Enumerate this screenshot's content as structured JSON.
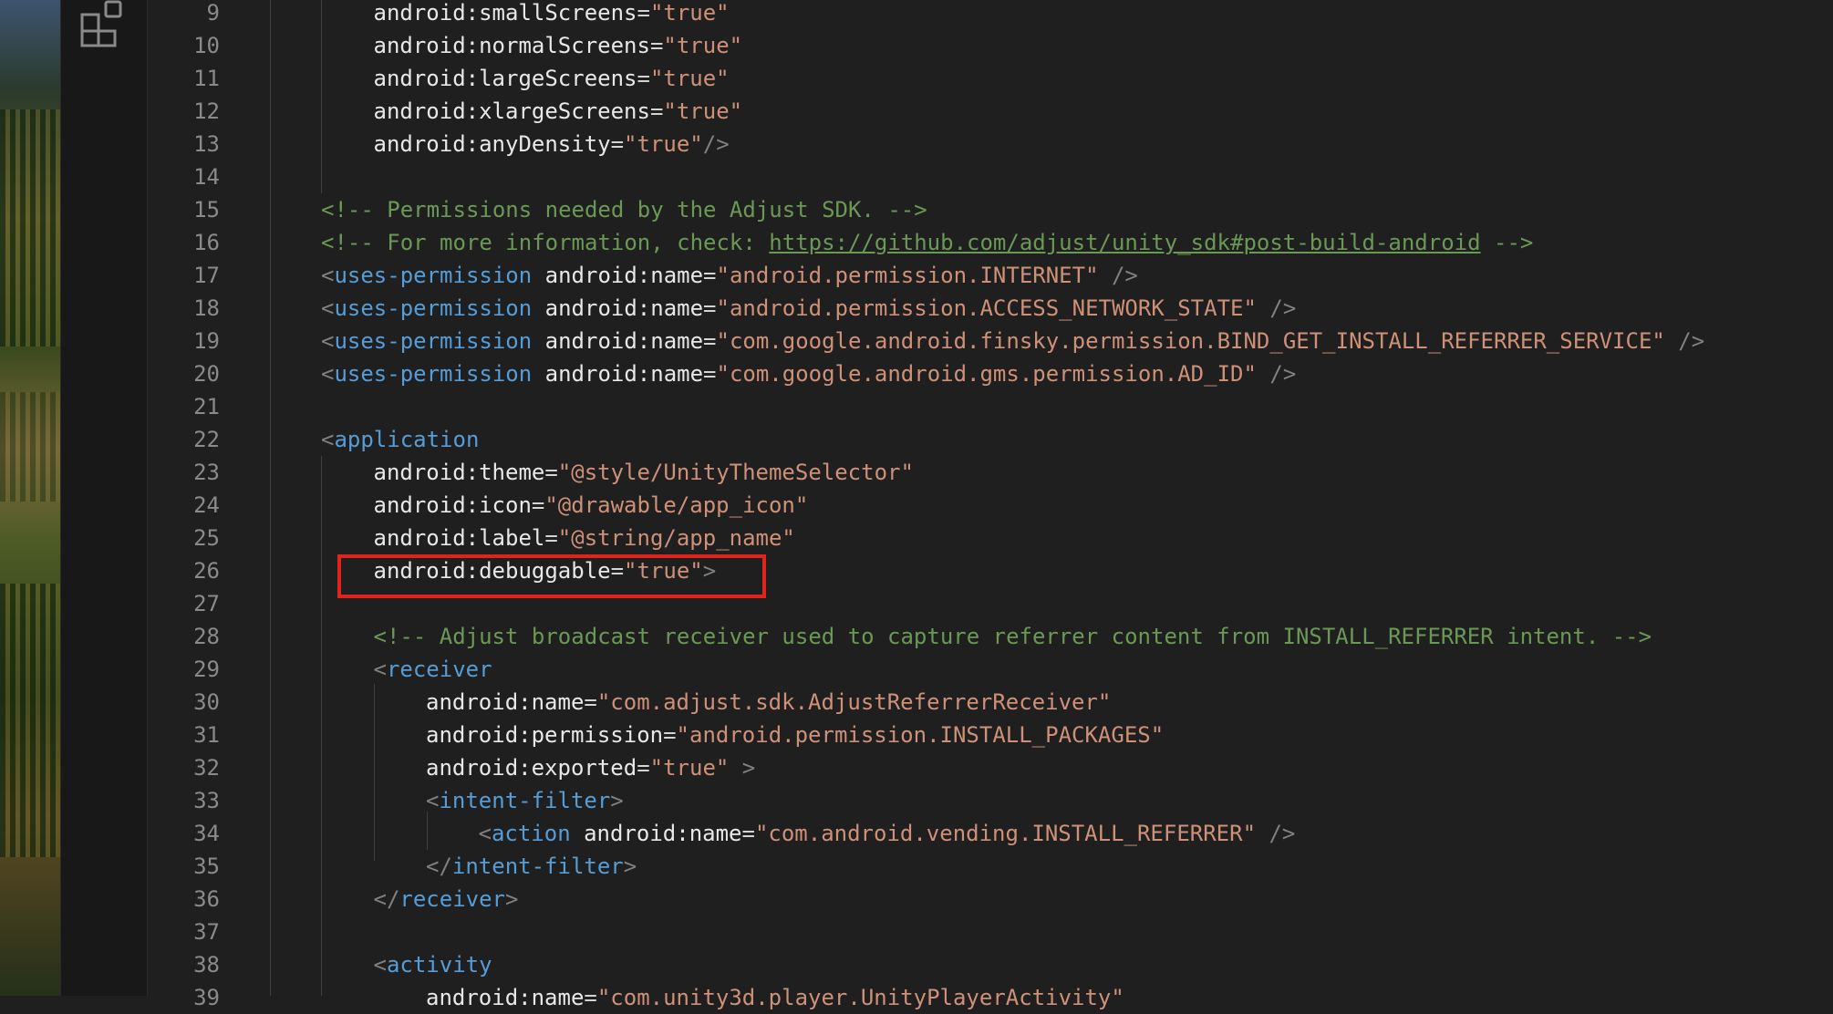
{
  "highlight_color": "#e0241c",
  "editor": {
    "lines": [
      {
        "num": "9",
        "tokens": [
          [
            "attr-w",
            "android:smallScreens"
          ],
          [
            "txt",
            "="
          ],
          [
            "str",
            "\"true\""
          ]
        ],
        "indent": 2
      },
      {
        "num": "10",
        "tokens": [
          [
            "attr-w",
            "android:normalScreens"
          ],
          [
            "txt",
            "="
          ],
          [
            "str",
            "\"true\""
          ]
        ],
        "indent": 2
      },
      {
        "num": "11",
        "tokens": [
          [
            "attr-w",
            "android:largeScreens"
          ],
          [
            "txt",
            "="
          ],
          [
            "str",
            "\"true\""
          ]
        ],
        "indent": 2
      },
      {
        "num": "12",
        "tokens": [
          [
            "attr-w",
            "android:xlargeScreens"
          ],
          [
            "txt",
            "="
          ],
          [
            "str",
            "\"true\""
          ]
        ],
        "indent": 2
      },
      {
        "num": "13",
        "tokens": [
          [
            "attr-w",
            "android:anyDensity"
          ],
          [
            "txt",
            "="
          ],
          [
            "str",
            "\"true\""
          ],
          [
            "brk",
            "/>"
          ]
        ],
        "indent": 2
      },
      {
        "num": "14",
        "tokens": [],
        "indent": 1
      },
      {
        "num": "15",
        "tokens": [
          [
            "com",
            "<!-- Permissions needed by the Adjust SDK. -->"
          ]
        ],
        "indent": 1
      },
      {
        "num": "16",
        "tokens": [
          [
            "com",
            "<!-- For more information, check: "
          ],
          [
            "link",
            "https://github.com/adjust/unity_sdk#post-build-android"
          ],
          [
            "com",
            " -->"
          ]
        ],
        "indent": 1
      },
      {
        "num": "17",
        "tokens": [
          [
            "brk",
            "<"
          ],
          [
            "tag",
            "uses-permission"
          ],
          [
            "txt",
            " "
          ],
          [
            "attr-w",
            "android:name"
          ],
          [
            "txt",
            "="
          ],
          [
            "str",
            "\"android.permission.INTERNET\""
          ],
          [
            "brk",
            " />"
          ]
        ],
        "indent": 1
      },
      {
        "num": "18",
        "tokens": [
          [
            "brk",
            "<"
          ],
          [
            "tag",
            "uses-permission"
          ],
          [
            "txt",
            " "
          ],
          [
            "attr-w",
            "android:name"
          ],
          [
            "txt",
            "="
          ],
          [
            "str",
            "\"android.permission.ACCESS_NETWORK_STATE\""
          ],
          [
            "brk",
            " />"
          ]
        ],
        "indent": 1
      },
      {
        "num": "19",
        "tokens": [
          [
            "brk",
            "<"
          ],
          [
            "tag",
            "uses-permission"
          ],
          [
            "txt",
            " "
          ],
          [
            "attr-w",
            "android:name"
          ],
          [
            "txt",
            "="
          ],
          [
            "str",
            "\"com.google.android.finsky.permission.BIND_GET_INSTALL_REFERRER_SERVICE\""
          ],
          [
            "brk",
            " />"
          ]
        ],
        "indent": 1
      },
      {
        "num": "20",
        "tokens": [
          [
            "brk",
            "<"
          ],
          [
            "tag",
            "uses-permission"
          ],
          [
            "txt",
            " "
          ],
          [
            "attr-w",
            "android:name"
          ],
          [
            "txt",
            "="
          ],
          [
            "str",
            "\"com.google.android.gms.permission.AD_ID\""
          ],
          [
            "brk",
            " />"
          ]
        ],
        "indent": 1
      },
      {
        "num": "21",
        "tokens": [],
        "indent": 1
      },
      {
        "num": "22",
        "tokens": [
          [
            "brk",
            "<"
          ],
          [
            "tag",
            "application"
          ]
        ],
        "indent": 1
      },
      {
        "num": "23",
        "tokens": [
          [
            "attr-w",
            "android:theme"
          ],
          [
            "txt",
            "="
          ],
          [
            "str",
            "\"@style/UnityThemeSelector\""
          ]
        ],
        "indent": 2
      },
      {
        "num": "24",
        "tokens": [
          [
            "attr-w",
            "android:icon"
          ],
          [
            "txt",
            "="
          ],
          [
            "str",
            "\"@drawable/app_icon\""
          ]
        ],
        "indent": 2
      },
      {
        "num": "25",
        "tokens": [
          [
            "attr-w",
            "android:label"
          ],
          [
            "txt",
            "="
          ],
          [
            "str",
            "\"@string/app_name\""
          ]
        ],
        "indent": 2
      },
      {
        "num": "26",
        "tokens": [
          [
            "attr-w",
            "android:debuggable"
          ],
          [
            "txt",
            "="
          ],
          [
            "str",
            "\"true\""
          ],
          [
            "brk",
            ">"
          ]
        ],
        "indent": 2
      },
      {
        "num": "27",
        "tokens": [],
        "indent": 2
      },
      {
        "num": "28",
        "tokens": [
          [
            "com",
            "<!-- Adjust broadcast receiver used to capture referrer content from INSTALL_REFERRER intent. -->"
          ]
        ],
        "indent": 2
      },
      {
        "num": "29",
        "tokens": [
          [
            "brk",
            "<"
          ],
          [
            "tag",
            "receiver"
          ]
        ],
        "indent": 2
      },
      {
        "num": "30",
        "tokens": [
          [
            "attr-w",
            "android:name"
          ],
          [
            "txt",
            "="
          ],
          [
            "str",
            "\"com.adjust.sdk.AdjustReferrerReceiver\""
          ]
        ],
        "indent": 3
      },
      {
        "num": "31",
        "tokens": [
          [
            "attr-w",
            "android:permission"
          ],
          [
            "txt",
            "="
          ],
          [
            "str",
            "\"android.permission.INSTALL_PACKAGES\""
          ]
        ],
        "indent": 3
      },
      {
        "num": "32",
        "tokens": [
          [
            "attr-w",
            "android:exported"
          ],
          [
            "txt",
            "="
          ],
          [
            "str",
            "\"true\""
          ],
          [
            "brk",
            " >"
          ]
        ],
        "indent": 3
      },
      {
        "num": "33",
        "tokens": [
          [
            "brk",
            "<"
          ],
          [
            "tag",
            "intent-filter"
          ],
          [
            "brk",
            ">"
          ]
        ],
        "indent": 3
      },
      {
        "num": "34",
        "tokens": [
          [
            "brk",
            "<"
          ],
          [
            "tag",
            "action"
          ],
          [
            "txt",
            " "
          ],
          [
            "attr-w",
            "android:name"
          ],
          [
            "txt",
            "="
          ],
          [
            "str",
            "\"com.android.vending.INSTALL_REFERRER\""
          ],
          [
            "brk",
            " />"
          ]
        ],
        "indent": 4
      },
      {
        "num": "35",
        "tokens": [
          [
            "brk",
            "</"
          ],
          [
            "tag",
            "intent-filter"
          ],
          [
            "brk",
            ">"
          ]
        ],
        "indent": 3
      },
      {
        "num": "36",
        "tokens": [
          [
            "brk",
            "</"
          ],
          [
            "tag",
            "receiver"
          ],
          [
            "brk",
            ">"
          ]
        ],
        "indent": 2
      },
      {
        "num": "37",
        "tokens": [],
        "indent": 2
      },
      {
        "num": "38",
        "tokens": [
          [
            "brk",
            "<"
          ],
          [
            "tag",
            "activity"
          ]
        ],
        "indent": 2
      },
      {
        "num": "39",
        "tokens": [
          [
            "attr-w",
            "android:name"
          ],
          [
            "txt",
            "="
          ],
          [
            "str",
            "\"com.unity3d.player.UnityPlayerActivity\""
          ]
        ],
        "indent": 3
      }
    ]
  }
}
